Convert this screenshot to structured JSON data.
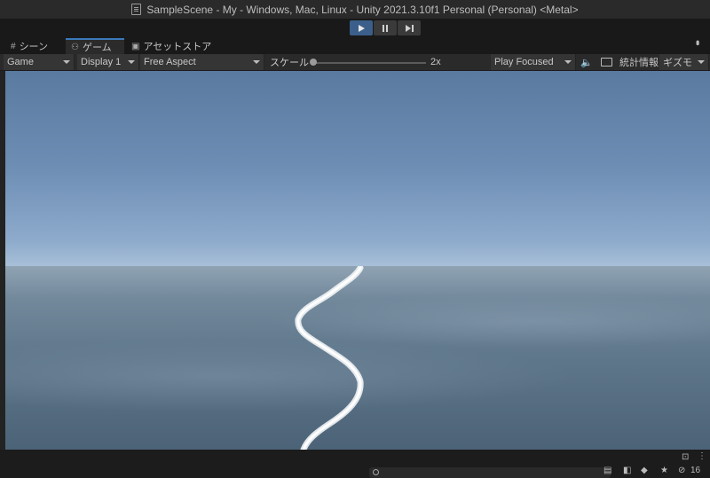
{
  "window": {
    "title": "SampleScene - My - Windows, Mac, Linux - Unity 2021.3.10f1 Personal (Personal) <Metal>"
  },
  "tabs": [
    {
      "label": "シーン",
      "icon": "grid-icon"
    },
    {
      "label": "ゲーム",
      "icon": "gamepad-icon",
      "active": true
    },
    {
      "label": "アセットストア",
      "icon": "shopping-bag-icon"
    }
  ],
  "toolbar": {
    "view_mode": "Game",
    "display": "Display 1",
    "aspect": "Free Aspect",
    "scale_label": "スケール",
    "scale_value": "2x",
    "play_mode": "Play Focused",
    "stats_label": "統計情報",
    "gizmos_label": "ギズモ"
  },
  "statusbar": {
    "count": "16"
  },
  "colors": {
    "play_active": "#3b5f8a",
    "tab_accent": "#3a79bb"
  }
}
